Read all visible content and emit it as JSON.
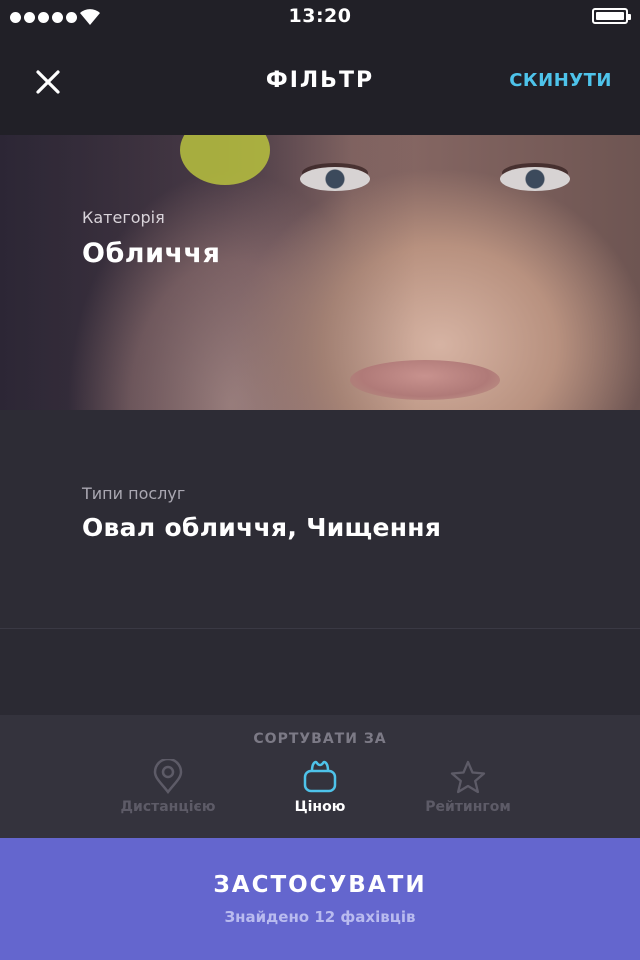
{
  "status_bar": {
    "time": "13:20",
    "signal_dots": 5
  },
  "header": {
    "title": "ФІЛЬТР",
    "reset_label": "СКИНУТИ",
    "close_icon": "close-icon",
    "accent_color": "#4ec3ea"
  },
  "category": {
    "label": "Категорія",
    "value": "Обличчя"
  },
  "service_types": {
    "label": "Типи послуг",
    "value": "Овал обличчя, Чищення"
  },
  "sort": {
    "title": "СОРТУВАТИ ЗА",
    "options": [
      {
        "label": "Дистанцією",
        "icon": "location-pin-icon",
        "active": false
      },
      {
        "label": "Ціною",
        "icon": "purse-icon",
        "active": true
      },
      {
        "label": "Рейтингом",
        "icon": "star-icon",
        "active": false
      }
    ]
  },
  "apply": {
    "label": "ЗАСТОСУВАТИ",
    "subtitle": "Знайдено 12 фахівців",
    "color": "#6466ce"
  }
}
